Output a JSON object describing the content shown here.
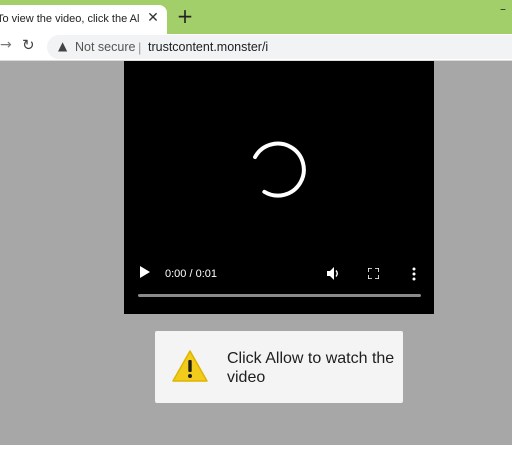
{
  "browser": {
    "tab": {
      "title": "To view the video, click the Allow button",
      "close_glyph": "✕"
    },
    "new_tab_glyph": "+",
    "window_minimize_glyph": "–",
    "toolbar": {
      "forward_glyph": "→",
      "reload_glyph": "↻",
      "security_icon": "warning-triangle",
      "security_label": "Not secure",
      "separator": "|",
      "url": "trustcontent.monster/i"
    }
  },
  "video_player": {
    "state": "loading",
    "time_display": "0:00 / 0:01",
    "progress": 0.0
  },
  "allow_prompt": {
    "icon": "warning-icon",
    "message": "Click Allow to watch the video"
  },
  "colors": {
    "tabbar": "#a3cf6a",
    "page_background": "#a7a7a7",
    "video_background": "#000000",
    "warning_yellow": "#f2cc1c"
  }
}
